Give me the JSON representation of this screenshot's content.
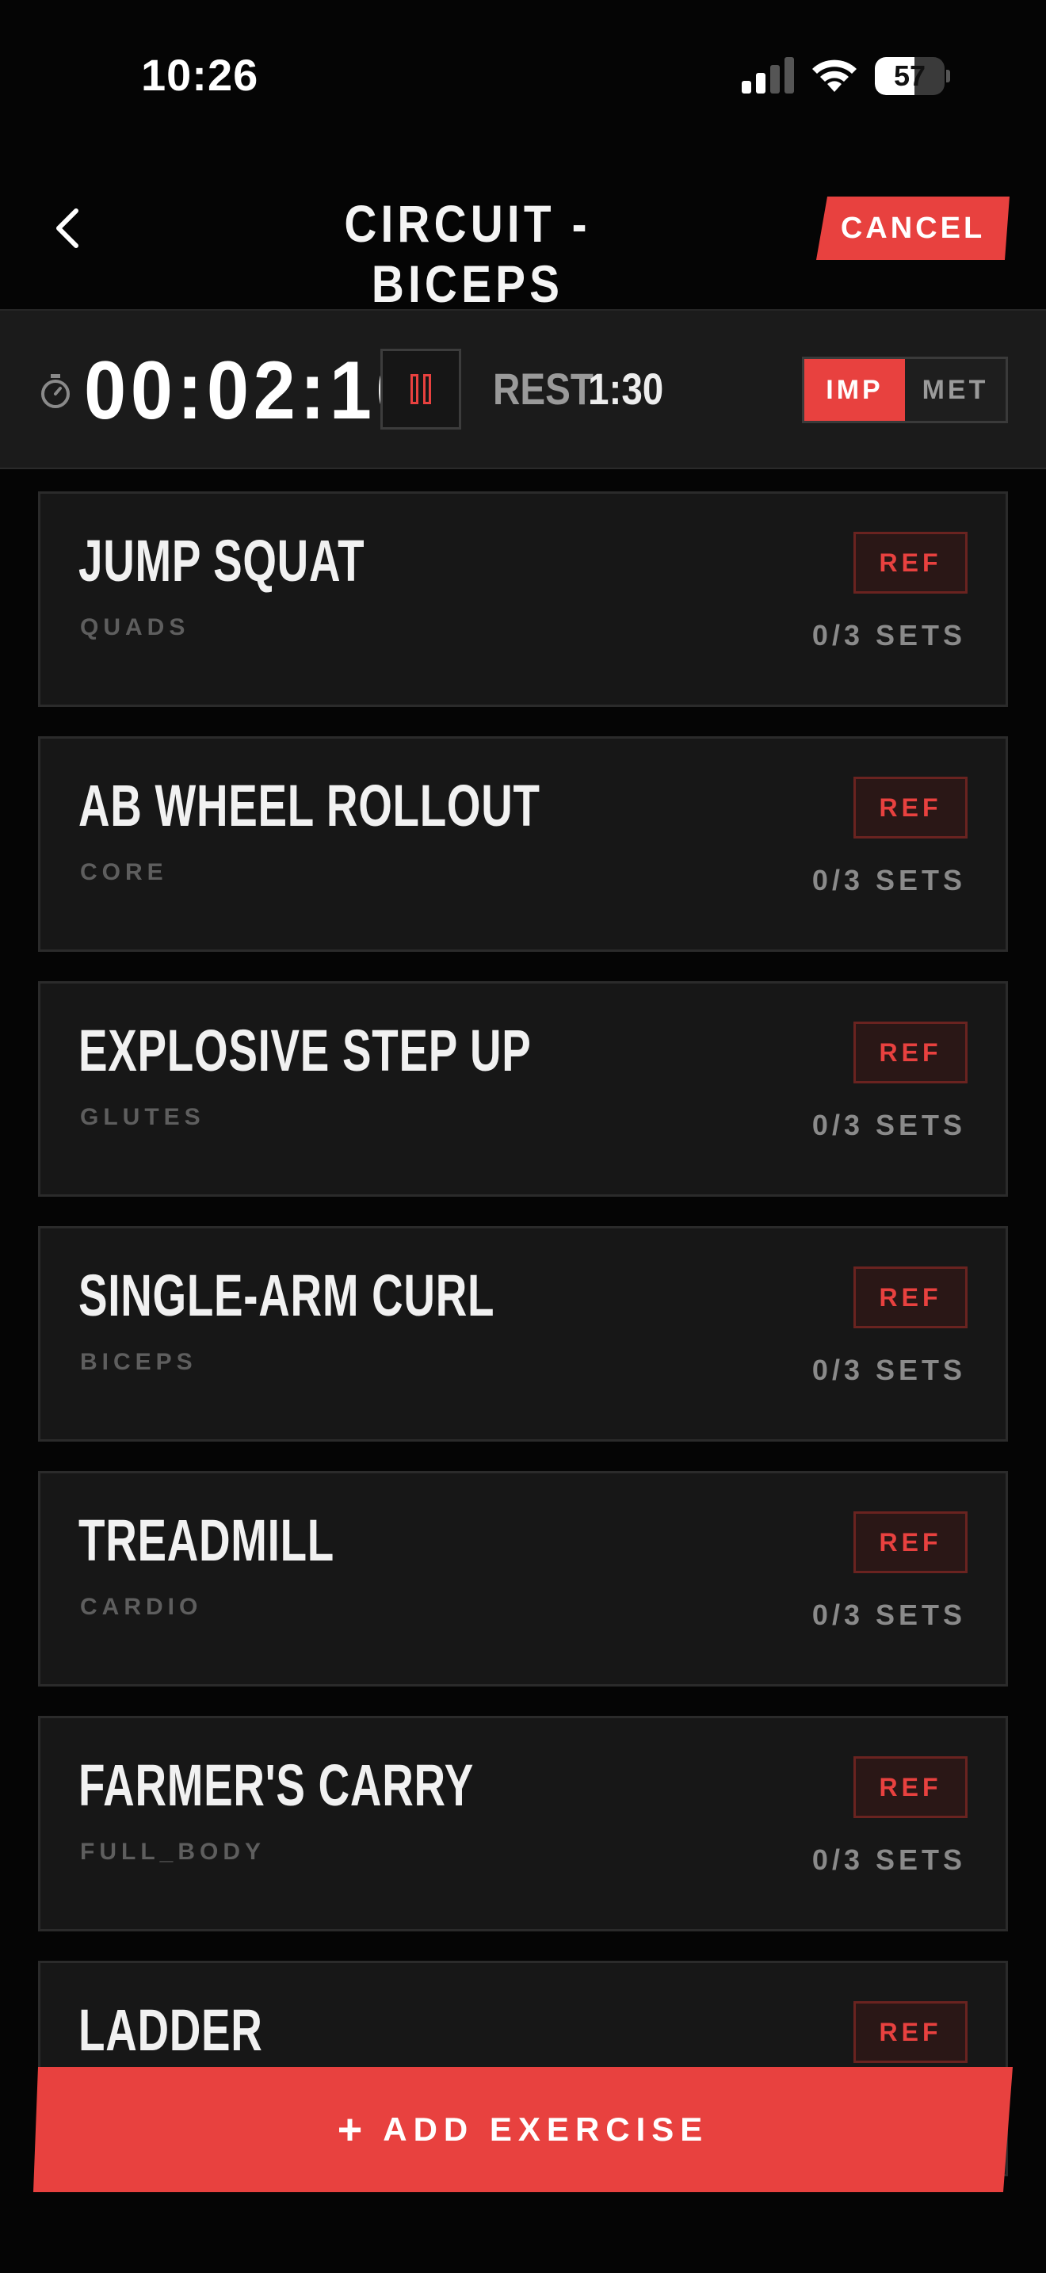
{
  "status_bar": {
    "time": "10:26",
    "battery_percent": "57",
    "battery_level": 0.57,
    "signal_icon": "cellular-signal-icon",
    "wifi_icon": "wifi-icon"
  },
  "header": {
    "title": "CIRCUIT - BICEPS",
    "cancel_label": "CANCEL",
    "back_icon": "chevron-left-icon"
  },
  "timer": {
    "elapsed": "00:02:10",
    "rest_label": "REST",
    "rest_value": "1:30",
    "units": [
      {
        "label": "IMP",
        "active": true
      },
      {
        "label": "MET",
        "active": false
      }
    ]
  },
  "exercises": [
    {
      "name": "JUMP SQUAT",
      "muscle": "QUADS",
      "ref_label": "REF",
      "sets": "0/3 SETS"
    },
    {
      "name": "AB WHEEL ROLLOUT",
      "muscle": "CORE",
      "ref_label": "REF",
      "sets": "0/3 SETS"
    },
    {
      "name": "EXPLOSIVE STEP UP",
      "muscle": "GLUTES",
      "ref_label": "REF",
      "sets": "0/3 SETS"
    },
    {
      "name": "SINGLE-ARM CURL",
      "muscle": "BICEPS",
      "ref_label": "REF",
      "sets": "0/3 SETS"
    },
    {
      "name": "TREADMILL",
      "muscle": "CARDIO",
      "ref_label": "REF",
      "sets": "0/3 SETS"
    },
    {
      "name": "FARMER'S CARRY",
      "muscle": "FULL_BODY",
      "ref_label": "REF",
      "sets": "0/3 SETS"
    },
    {
      "name": "LADDER",
      "muscle": "",
      "ref_label": "REF",
      "sets": ""
    }
  ],
  "add_exercise": {
    "plus": "+",
    "label": "ADD EXERCISE"
  },
  "colors": {
    "accent": "#e8413f",
    "background": "#050505",
    "card": "#171717"
  }
}
